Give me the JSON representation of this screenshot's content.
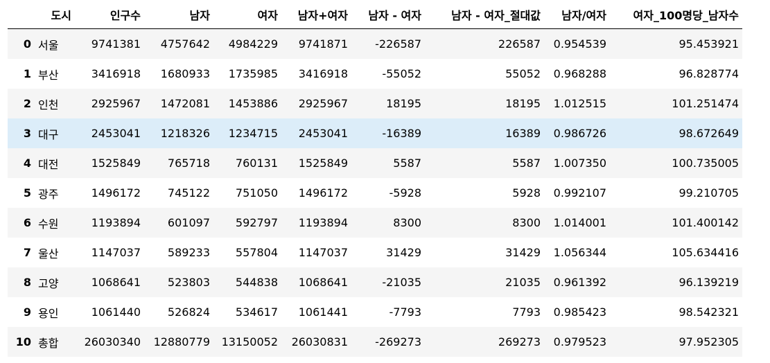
{
  "table": {
    "columns": [
      "",
      "도시",
      "인구수",
      "남자",
      "여자",
      "남자+여자",
      "남자 - 여자",
      "남자 - 여자_절대값",
      "남자/여자",
      "여자_100명당_남자수"
    ],
    "rows": [
      {
        "index": "0",
        "cells": [
          "서울",
          "9741381",
          "4757642",
          "4984229",
          "9741871",
          "-226587",
          "226587",
          "0.954539",
          "95.453921"
        ]
      },
      {
        "index": "1",
        "cells": [
          "부산",
          "3416918",
          "1680933",
          "1735985",
          "3416918",
          "-55052",
          "55052",
          "0.968288",
          "96.828774"
        ]
      },
      {
        "index": "2",
        "cells": [
          "인천",
          "2925967",
          "1472081",
          "1453886",
          "2925967",
          "18195",
          "18195",
          "1.012515",
          "101.251474"
        ]
      },
      {
        "index": "3",
        "cells": [
          "대구",
          "2453041",
          "1218326",
          "1234715",
          "2453041",
          "-16389",
          "16389",
          "0.986726",
          "98.672649"
        ]
      },
      {
        "index": "4",
        "cells": [
          "대전",
          "1525849",
          "765718",
          "760131",
          "1525849",
          "5587",
          "5587",
          "1.007350",
          "100.735005"
        ]
      },
      {
        "index": "5",
        "cells": [
          "광주",
          "1496172",
          "745122",
          "751050",
          "1496172",
          "-5928",
          "5928",
          "0.992107",
          "99.210705"
        ]
      },
      {
        "index": "6",
        "cells": [
          "수원",
          "1193894",
          "601097",
          "592797",
          "1193894",
          "8300",
          "8300",
          "1.014001",
          "101.400142"
        ]
      },
      {
        "index": "7",
        "cells": [
          "울산",
          "1147037",
          "589233",
          "557804",
          "1147037",
          "31429",
          "31429",
          "1.056344",
          "105.634416"
        ]
      },
      {
        "index": "8",
        "cells": [
          "고양",
          "1068641",
          "523803",
          "544838",
          "1068641",
          "-21035",
          "21035",
          "0.961392",
          "96.139219"
        ]
      },
      {
        "index": "9",
        "cells": [
          "용인",
          "1061440",
          "526824",
          "534617",
          "1061441",
          "-7793",
          "7793",
          "0.985423",
          "98.542321"
        ]
      },
      {
        "index": "10",
        "cells": [
          "총합",
          "26030340",
          "12880779",
          "13150052",
          "26030831",
          "-269273",
          "269273",
          "0.979523",
          "97.952305"
        ]
      }
    ],
    "hovered_row": 3,
    "colors": {
      "stripe": "#f5f5f5",
      "hover": "#dcedf9",
      "header_rule": "#000000"
    }
  }
}
